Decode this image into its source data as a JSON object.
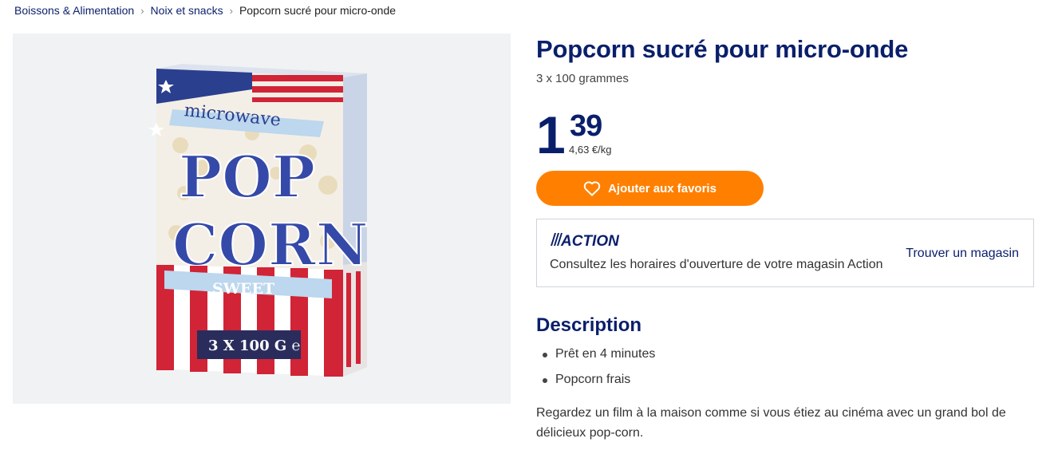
{
  "breadcrumb": {
    "items": [
      "Boissons & Alimentation",
      "Noix et snacks"
    ],
    "current": "Popcorn sucré pour micro-onde"
  },
  "product": {
    "title": "Popcorn sucré pour micro-onde",
    "subtitle": "3 x 100 grammes",
    "price_int": "1",
    "price_dec": "39",
    "price_unit": "4,63 €/kg",
    "image": {
      "box_text_top": "microwave",
      "box_text_pop": "POP",
      "box_text_corn": "CORN",
      "box_text_sweet": "SWEET",
      "box_text_qty": "3 X 100 G ℮"
    }
  },
  "favorite_button": {
    "label": "Ajouter aux favoris",
    "icon": "heart-icon"
  },
  "store": {
    "logo": "ACTION",
    "hours_text": "Consultez les horaires d'ouverture de votre magasin Action",
    "find_label": "Trouver un magasin"
  },
  "description": {
    "title": "Description",
    "bullets": [
      "Prêt en 4 minutes",
      "Popcorn frais"
    ],
    "text": "Regardez un film à la maison comme si vous étiez au cinéma avec un grand bol de délicieux pop-corn."
  },
  "colors": {
    "brand_blue": "#0a1f6b",
    "accent_orange": "#ff8000",
    "image_bg": "#f1f2f4"
  }
}
